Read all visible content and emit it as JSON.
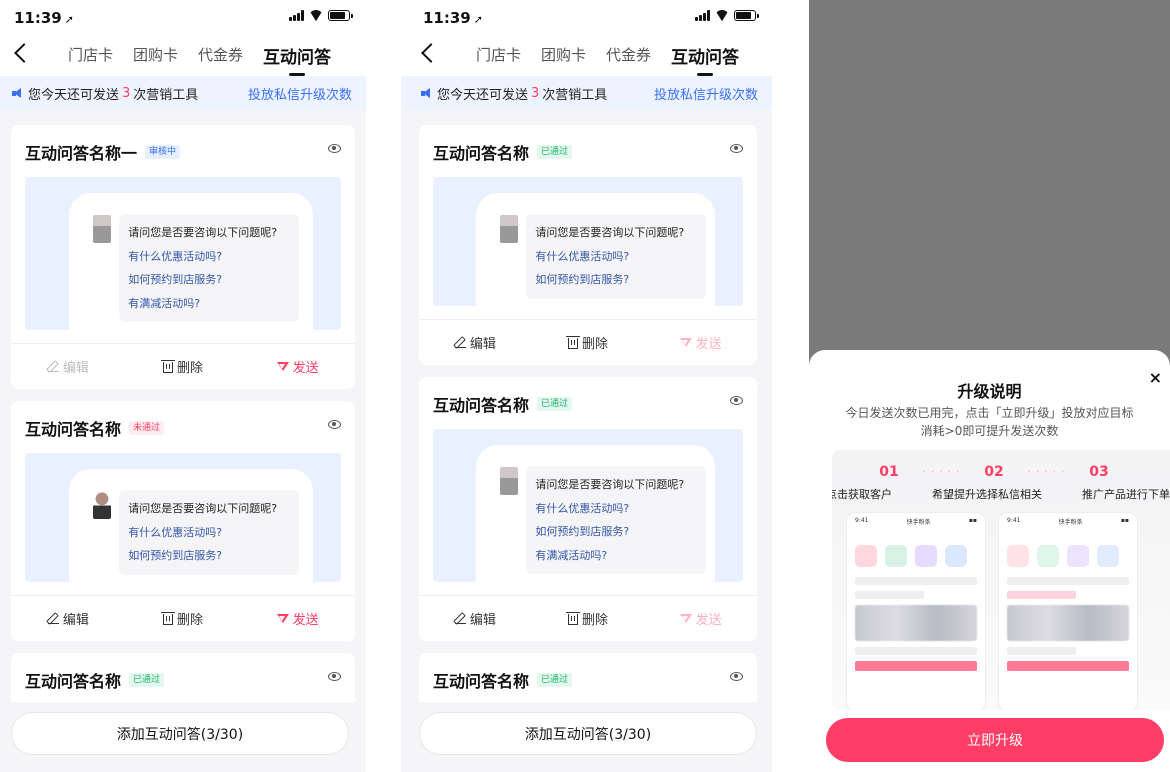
{
  "status": {
    "time": "11:39",
    "location_arrow": "➚"
  },
  "nav": {
    "tabs": [
      "门店卡",
      "团购卡",
      "代金券",
      "互动问答"
    ],
    "active_tab": "互动问答"
  },
  "notice": {
    "prefix": "您今天还可发送",
    "count": "3",
    "suffix": "次营销工具",
    "link": "投放私信升级次数"
  },
  "preview": {
    "question": "请问您是否要咨询以下问题呢?",
    "options": [
      "有什么优惠活动吗?",
      "如何预约到店服务?",
      "有满减活动吗?"
    ]
  },
  "actions": {
    "edit": "编辑",
    "delete": "删除",
    "send": "发送"
  },
  "screen1": {
    "cards": [
      {
        "title": "互动问答名称一",
        "badge": "审核中"
      },
      {
        "title": "互动问答名称",
        "badge": "未通过"
      },
      {
        "title": "互动问答名称",
        "badge": "已通过"
      }
    ]
  },
  "screen2": {
    "cards": [
      {
        "title": "互动问答名称",
        "badge": "已通过"
      },
      {
        "title": "互动问答名称",
        "badge": "已通过"
      },
      {
        "title": "互动问答名称",
        "badge": "已通过"
      }
    ]
  },
  "add_button": "添加互动问答(3/30)",
  "modal": {
    "close": "×",
    "title": "升级说明",
    "desc_line1": "今日发送次数已用完，点击「立即升级」投放对应目标",
    "desc_line2": "消耗>0即可提升发送次数",
    "steps": [
      {
        "num": "01",
        "label": "点击获取客户"
      },
      {
        "num": "02",
        "label": "希望提升选择私信相关"
      },
      {
        "num": "03",
        "label": "推广产品进行下单"
      }
    ],
    "dots": "· · · · ·",
    "mini_screen_title": "快手粉条",
    "mini_time": "9:41",
    "button": "立即升级"
  },
  "colors": {
    "accent_red": "#ff3d65",
    "link_blue": "#3b6ff5",
    "notice_bg": "#eef4ff",
    "preview_bg": "#e9f0ff",
    "pass_green": "#21b36b"
  }
}
